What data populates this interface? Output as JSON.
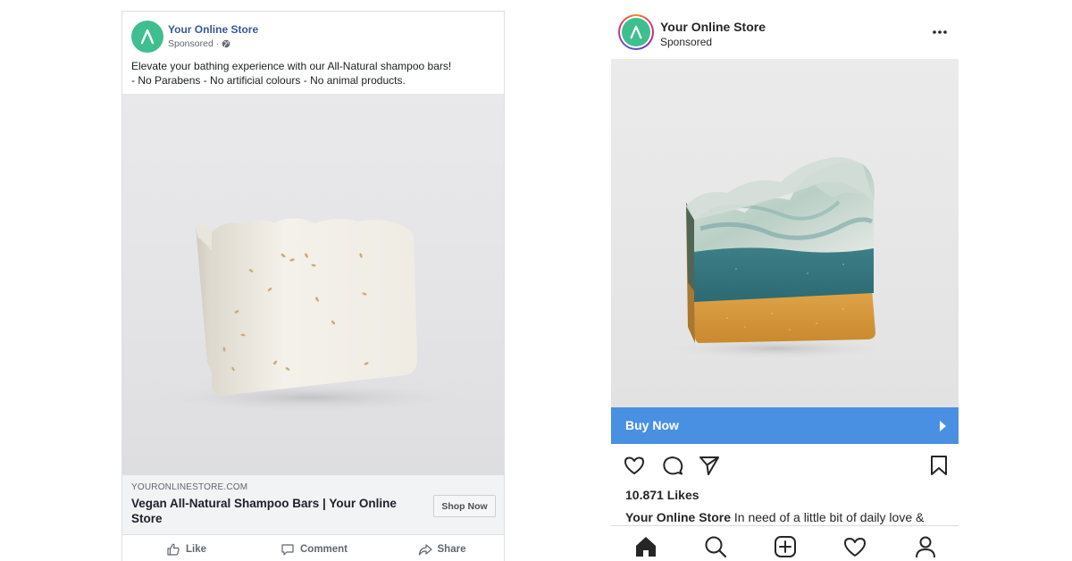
{
  "facebook": {
    "page_name": "Your Online Store",
    "sponsored": "Sponsored ·",
    "post_line1": "Elevate your bathing experience with our All-Natural shampoo bars!",
    "post_line2": "- No Parabens - No artificial colours - No animal products.",
    "domain": "YOURONLINESTORE.COM",
    "headline": "Vegan All-Natural Shampoo Bars | Your Online Store",
    "cta": "Shop Now",
    "actions": [
      "Like",
      "Comment",
      "Share"
    ],
    "icons": {
      "like": "thumbs-up-icon",
      "comment": "comment-icon",
      "share": "share-icon",
      "privacy": "globe-icon"
    },
    "brand_color": "#385898"
  },
  "instagram": {
    "account_name": "Your Online Store",
    "sponsored": "Sponsored",
    "cta": "Buy Now",
    "likes": "10.871 Likes",
    "caption_user": "Your Online Store",
    "caption_text": " In need of a little bit of daily love &",
    "cta_color": "#4a90e2",
    "icons": {
      "more": "more-icon",
      "like": "heart-icon",
      "comment": "comment-icon",
      "share": "send-icon",
      "save": "bookmark-icon",
      "cta_arrow": "arrow-right-icon"
    },
    "nav": [
      "home-icon",
      "search-icon",
      "add-icon",
      "heart-icon",
      "profile-icon"
    ]
  },
  "brand": {
    "logo_color": "#3fbe8f"
  }
}
